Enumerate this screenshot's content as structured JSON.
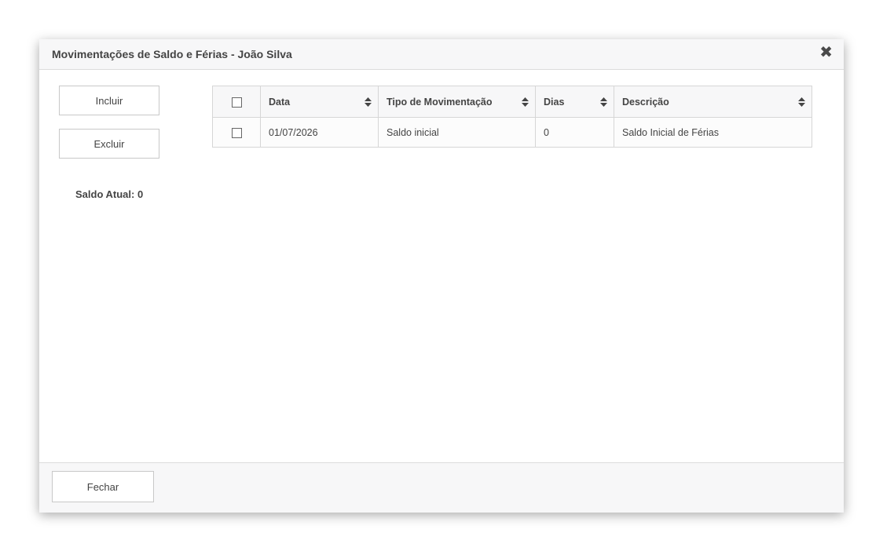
{
  "dialog": {
    "title": "Movimentações de Saldo e Férias - João Silva",
    "close_icon": "times-icon"
  },
  "actions": {
    "incluir_label": "Incluir",
    "excluir_label": "Excluir"
  },
  "saldo": {
    "label": "Saldo Atual: 0"
  },
  "table": {
    "columns": [
      "Data",
      "Tipo de Movimentação",
      "Dias",
      "Descrição"
    ],
    "rows": [
      {
        "data": "01/07/2026",
        "tipo": "Saldo inicial",
        "dias": "0",
        "descricao": "Saldo Inicial de Férias"
      }
    ]
  },
  "footer": {
    "fechar_label": "Fechar"
  }
}
